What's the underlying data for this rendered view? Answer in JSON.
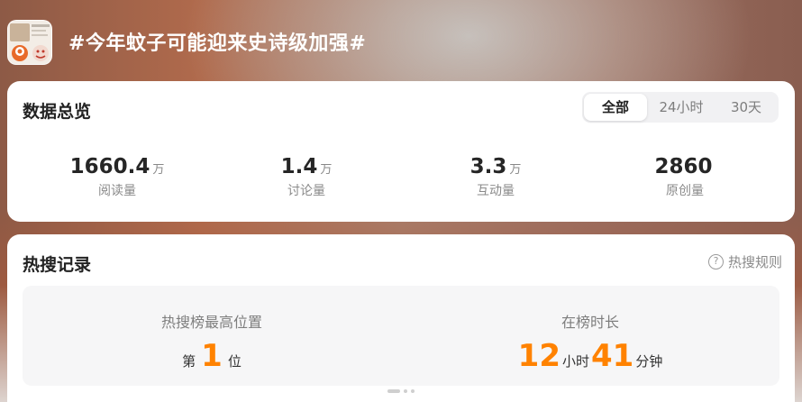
{
  "topic": {
    "title": "#今年蚊子可能迎来史诗级加强#"
  },
  "overview": {
    "title": "数据总览",
    "tabs": [
      {
        "label": "全部",
        "selected": true
      },
      {
        "label": "24小时",
        "selected": false
      },
      {
        "label": "30天",
        "selected": false
      }
    ],
    "stats": [
      {
        "value": "1660.4",
        "unit": "万",
        "label": "阅读量"
      },
      {
        "value": "1.4",
        "unit": "万",
        "label": "讨论量"
      },
      {
        "value": "3.3",
        "unit": "万",
        "label": "互动量"
      },
      {
        "value": "2860",
        "unit": "",
        "label": "原创量"
      }
    ]
  },
  "hot_search": {
    "title": "热搜记录",
    "rules_label": "热搜规则",
    "best_rank": {
      "label": "热搜榜最高位置",
      "prefix": "第",
      "value": "1",
      "suffix": "位"
    },
    "duration": {
      "label": "在榜时长",
      "hours": "12",
      "hours_unit": "小时",
      "minutes": "41",
      "minutes_unit": "分钟"
    }
  },
  "colors": {
    "accent_orange": "#ff8200",
    "card_bg": "#ffffff",
    "panel_bg": "#f6f6f7"
  },
  "icons": {
    "help": "question-circle-icon",
    "avatar": "topic-avatar-image"
  }
}
